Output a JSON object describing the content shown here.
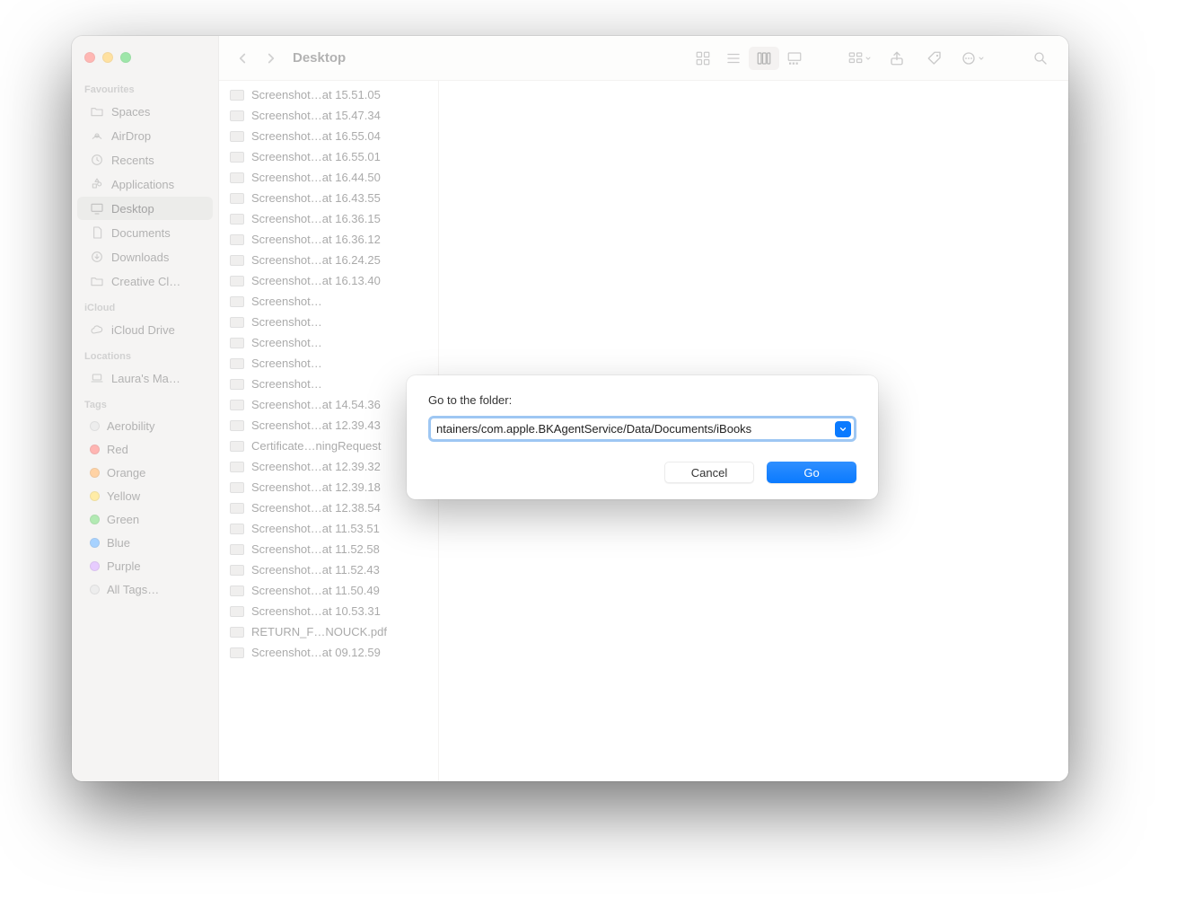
{
  "window": {
    "title": "Desktop"
  },
  "sidebar": {
    "sections": [
      {
        "label": "Favourites",
        "items": [
          {
            "icon": "folder",
            "label": "Spaces"
          },
          {
            "icon": "airdrop",
            "label": "AirDrop"
          },
          {
            "icon": "clock",
            "label": "Recents"
          },
          {
            "icon": "apps",
            "label": "Applications"
          },
          {
            "icon": "desktop",
            "label": "Desktop",
            "selected": true
          },
          {
            "icon": "doc",
            "label": "Documents"
          },
          {
            "icon": "download",
            "label": "Downloads"
          },
          {
            "icon": "folder",
            "label": "Creative Cl…"
          }
        ]
      },
      {
        "label": "iCloud",
        "items": [
          {
            "icon": "cloud",
            "label": "iCloud Drive"
          }
        ]
      },
      {
        "label": "Locations",
        "items": [
          {
            "icon": "laptop",
            "label": "Laura's Ma…"
          }
        ]
      },
      {
        "label": "Tags",
        "items": [
          {
            "icon": "tag",
            "label": "Aerobility",
            "color": "#d8d8d8"
          },
          {
            "icon": "tag",
            "label": "Red",
            "color": "#ff5b54"
          },
          {
            "icon": "tag",
            "label": "Orange",
            "color": "#ff9b36"
          },
          {
            "icon": "tag",
            "label": "Yellow",
            "color": "#ffd53a"
          },
          {
            "icon": "tag",
            "label": "Green",
            "color": "#55d158"
          },
          {
            "icon": "tag",
            "label": "Blue",
            "color": "#3d9bff"
          },
          {
            "icon": "tag",
            "label": "Purple",
            "color": "#c98fff"
          },
          {
            "icon": "tag",
            "label": "All Tags…",
            "color": "#d8d8d8"
          }
        ]
      }
    ]
  },
  "files": [
    "Screenshot…at 15.51.05",
    "Screenshot…at 15.47.34",
    "Screenshot…at 16.55.04",
    "Screenshot…at 16.55.01",
    "Screenshot…at 16.44.50",
    "Screenshot…at 16.43.55",
    "Screenshot…at 16.36.15",
    "Screenshot…at 16.36.12",
    "Screenshot…at 16.24.25",
    "Screenshot…at 16.13.40",
    "Screenshot…",
    "Screenshot…",
    "Screenshot…",
    "Screenshot…",
    "Screenshot…",
    "Screenshot…at 14.54.36",
    "Screenshot…at 12.39.43",
    "Certificate…ningRequest",
    "Screenshot…at 12.39.32",
    "Screenshot…at 12.39.18",
    "Screenshot…at 12.38.54",
    "Screenshot…at 11.53.51",
    "Screenshot…at 11.52.58",
    "Screenshot…at 11.52.43",
    "Screenshot…at 11.50.49",
    "Screenshot…at 10.53.31",
    "RETURN_F…NOUCK.pdf",
    "Screenshot…at 09.12.59"
  ],
  "dialog": {
    "label": "Go to the folder:",
    "input_value": "ntainers/com.apple.BKAgentService/Data/Documents/iBooks",
    "cancel_label": "Cancel",
    "go_label": "Go"
  }
}
